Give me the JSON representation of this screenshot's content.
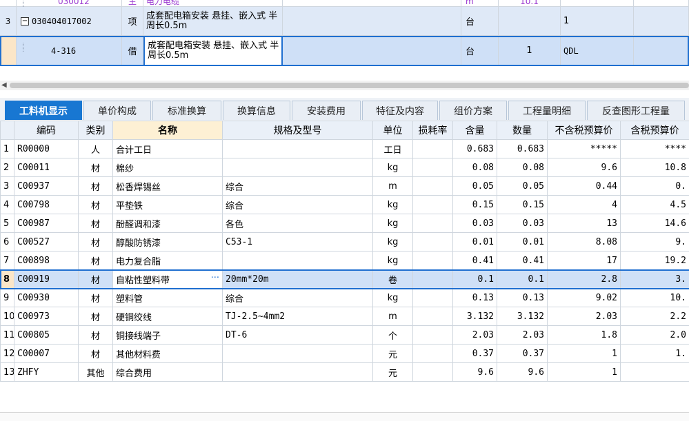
{
  "top_grid": {
    "row_top": {
      "code": "030012",
      "type": "主",
      "name": "电力电缆",
      "unit": "m",
      "qty": "10.1"
    },
    "row_3": {
      "num": "3",
      "code": "030404017002",
      "type": "项",
      "name": "成套配电箱安装 悬挂、嵌入式 半周长0.5m",
      "unit": "台",
      "price": "1"
    },
    "row_sub": {
      "code": "4-316",
      "type": "借",
      "name": "成套配电箱安装 悬挂、嵌入式 半周长0.5m",
      "unit": "台",
      "qty": "1",
      "price": "QDL"
    }
  },
  "tabs": [
    "工料机显示",
    "单价构成",
    "标准换算",
    "换算信息",
    "安装费用",
    "特征及内容",
    "组价方案",
    "工程量明细",
    "反查图形工程量"
  ],
  "active_tab": "工料机显示",
  "table": {
    "headers": [
      "",
      "编码",
      "类别",
      "名称",
      "规格及型号",
      "单位",
      "损耗率",
      "含量",
      "数量",
      "不含税预算价",
      "含税预算价"
    ],
    "rows": [
      {
        "num": "1",
        "code": "R00000",
        "cat": "人",
        "name": "合计工日",
        "spec": "",
        "unit": "工日",
        "loss": "",
        "content": "0.683",
        "qty": "0.683",
        "price_ex": "*****",
        "price_in": "****"
      },
      {
        "num": "2",
        "code": "C00011",
        "cat": "材",
        "name": "棉纱",
        "spec": "",
        "unit": "kg",
        "loss": "",
        "content": "0.08",
        "qty": "0.08",
        "price_ex": "9.6",
        "price_in": "10.8"
      },
      {
        "num": "3",
        "code": "C00937",
        "cat": "材",
        "name": "松香焊锡丝",
        "spec": "综合",
        "unit": "m",
        "loss": "",
        "content": "0.05",
        "qty": "0.05",
        "price_ex": "0.44",
        "price_in": "0."
      },
      {
        "num": "4",
        "code": "C00798",
        "cat": "材",
        "name": "平垫铁",
        "spec": "综合",
        "unit": "kg",
        "loss": "",
        "content": "0.15",
        "qty": "0.15",
        "price_ex": "4",
        "price_in": "4.5"
      },
      {
        "num": "5",
        "code": "C00987",
        "cat": "材",
        "name": "酚醛调和漆",
        "spec": "各色",
        "unit": "kg",
        "loss": "",
        "content": "0.03",
        "qty": "0.03",
        "price_ex": "13",
        "price_in": "14.6"
      },
      {
        "num": "6",
        "code": "C00527",
        "cat": "材",
        "name": "醇酸防锈漆",
        "spec": "C53-1",
        "unit": "kg",
        "loss": "",
        "content": "0.01",
        "qty": "0.01",
        "price_ex": "8.08",
        "price_in": "9."
      },
      {
        "num": "7",
        "code": "C00898",
        "cat": "材",
        "name": "电力复合脂",
        "spec": "",
        "unit": "kg",
        "loss": "",
        "content": "0.41",
        "qty": "0.41",
        "price_ex": "17",
        "price_in": "19.2"
      },
      {
        "num": "8",
        "code": "C00919",
        "cat": "材",
        "name": "自粘性塑料带",
        "spec": "20mm*20m",
        "unit": "卷",
        "loss": "",
        "content": "0.1",
        "qty": "0.1",
        "price_ex": "2.8",
        "price_in": "3."
      },
      {
        "num": "9",
        "code": "C00930",
        "cat": "材",
        "name": "塑料管",
        "spec": "综合",
        "unit": "kg",
        "loss": "",
        "content": "0.13",
        "qty": "0.13",
        "price_ex": "9.02",
        "price_in": "10."
      },
      {
        "num": "10",
        "code": "C00973",
        "cat": "材",
        "name": "硬铜绞线",
        "spec": "TJ-2.5~4mm2",
        "unit": "m",
        "loss": "",
        "content": "3.132",
        "qty": "3.132",
        "price_ex": "2.03",
        "price_in": "2.2"
      },
      {
        "num": "11",
        "code": "C00805",
        "cat": "材",
        "name": "铜接线端子",
        "spec": "DT-6",
        "unit": "个",
        "loss": "",
        "content": "2.03",
        "qty": "2.03",
        "price_ex": "1.8",
        "price_in": "2.0"
      },
      {
        "num": "12",
        "code": "C00007",
        "cat": "材",
        "name": "其他材料费",
        "spec": "",
        "unit": "元",
        "loss": "",
        "content": "0.37",
        "qty": "0.37",
        "price_ex": "1",
        "price_in": "1."
      },
      {
        "num": "13",
        "code": "ZHFY",
        "cat": "其他",
        "name": "综合费用",
        "spec": "",
        "unit": "元",
        "loss": "",
        "content": "9.6",
        "qty": "9.6",
        "price_ex": "1",
        "price_in": ""
      }
    ]
  },
  "selected_row": "8",
  "colors": {
    "accent": "#1877d2",
    "selection": "#cfe0f7",
    "row_number_highlight": "#fbe6c8"
  }
}
